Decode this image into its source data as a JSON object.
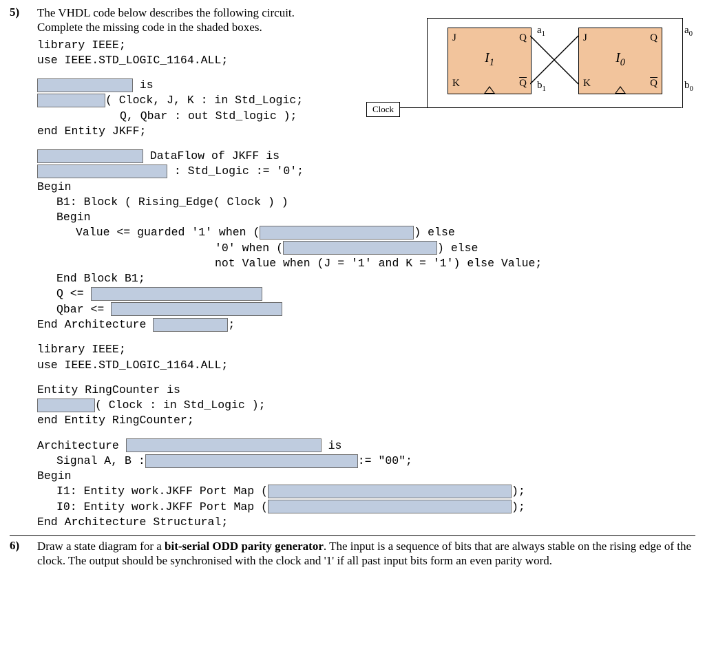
{
  "q5": {
    "number": "5)",
    "intro1": "The VHDL code below describes the following circuit.",
    "intro2": "Complete the missing code in the shaded boxes.",
    "code": {
      "l1": "library IEEE;",
      "l2": "use IEEE.STD_LOGIC_1164.ALL;",
      "l3a": " is",
      "l4a": "( Clock, J, K : in Std_Logic;",
      "l5": "Q, Qbar : out Std_logic );",
      "l6": "end Entity JKFF;",
      "l7a": " DataFlow of JKFF is",
      "l8a": " : Std_Logic := '0';",
      "l9": "Begin",
      "l10": "B1: Block ( Rising_Edge( Clock ) )",
      "l11": "Begin",
      "l12a": "Value <= guarded  '1' when  (",
      "l12b": ")  else",
      "l13a": "'0' when  (",
      "l13b": ")  else",
      "l14": "not Value when  (J = '1' and K = '1') else Value;",
      "l15": "End Block B1;",
      "l16": "Q    <= ",
      "l17": "Qbar <= ",
      "l18a": "End Architecture ",
      "l18b": ";",
      "l20": "library IEEE;",
      "l21": "use IEEE.STD_LOGIC_1164.ALL;",
      "l22": "Entity RingCounter is",
      "l23a": "( Clock : in Std_Logic );",
      "l24": "end Entity RingCounter;",
      "l25a": "Architecture ",
      "l25b": " is",
      "l26a": "Signal A, B :",
      "l26b": ":= \"00\";",
      "l27": "Begin",
      "l28a": "I1: Entity work.JKFF Port Map  (",
      "l28b": ");",
      "l29a": "I0: Entity work.JKFF Port Map  (",
      "l29b": ");",
      "l30": "End Architecture Structural;"
    }
  },
  "circuit": {
    "clock": "Clock",
    "ff1": {
      "name": "I",
      "sub": "1",
      "J": "J",
      "K": "K",
      "Q": "Q",
      "Qb": "Q"
    },
    "ff0": {
      "name": "I",
      "sub": "0",
      "J": "J",
      "K": "K",
      "Q": "Q",
      "Qb": "Q"
    },
    "a1": "a",
    "a1s": "1",
    "b1": "b",
    "b1s": "1",
    "a0": "a",
    "a0s": "0",
    "b0": "b",
    "b0s": "0"
  },
  "q6": {
    "number": "6)",
    "text": "Draw a state diagram for a bit-serial ODD parity generator. The input is a sequence of bits that are always stable on the rising edge of the clock. The output should be synchronised with the clock and '1' if all past input bits form an even parity word.",
    "boldPart": "bit-serial ODD parity generator"
  }
}
